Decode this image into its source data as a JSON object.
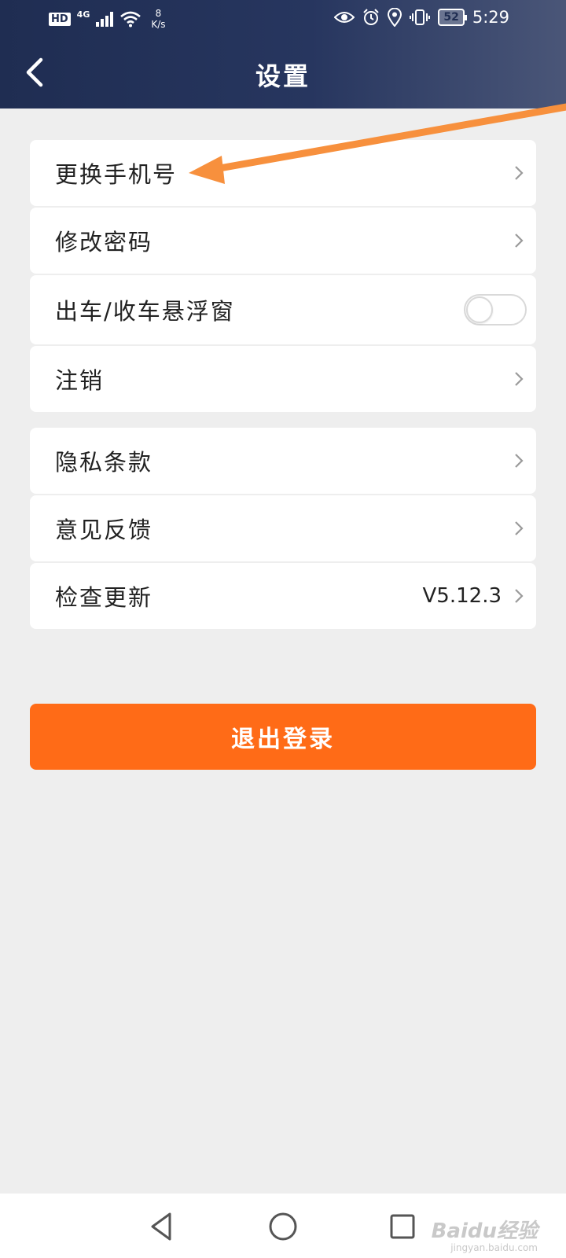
{
  "status_bar": {
    "hd": "HD",
    "network": "4G",
    "speed_value": "8",
    "speed_unit": "K/s",
    "battery": "52",
    "time": "5:29",
    "icons": [
      "eye-icon",
      "alarm-icon",
      "location-icon",
      "vibrate-icon"
    ]
  },
  "header": {
    "title": "设置",
    "back_icon": "chevron-left-icon"
  },
  "settings": {
    "group1": [
      {
        "label": "更换手机号"
      },
      {
        "label": "修改密码"
      },
      {
        "label": "出车/收车悬浮窗",
        "toggle_on": false
      },
      {
        "label": "注销"
      }
    ],
    "group2": [
      {
        "label": "隐私条款"
      },
      {
        "label": "意见反馈"
      },
      {
        "label": "检查更新",
        "value": "V5.12.3"
      }
    ]
  },
  "logout_label": "退出登录",
  "colors": {
    "header": "#1f2d52",
    "accent": "#ff6b17",
    "annotation": "#f7903d",
    "background": "#eeeeee"
  },
  "nav_bar": {
    "icons": [
      "back-triangle-icon",
      "home-circle-icon",
      "recents-square-icon"
    ]
  },
  "watermark": {
    "main": "Baidu经验",
    "sub": "jingyan.baidu.com"
  }
}
